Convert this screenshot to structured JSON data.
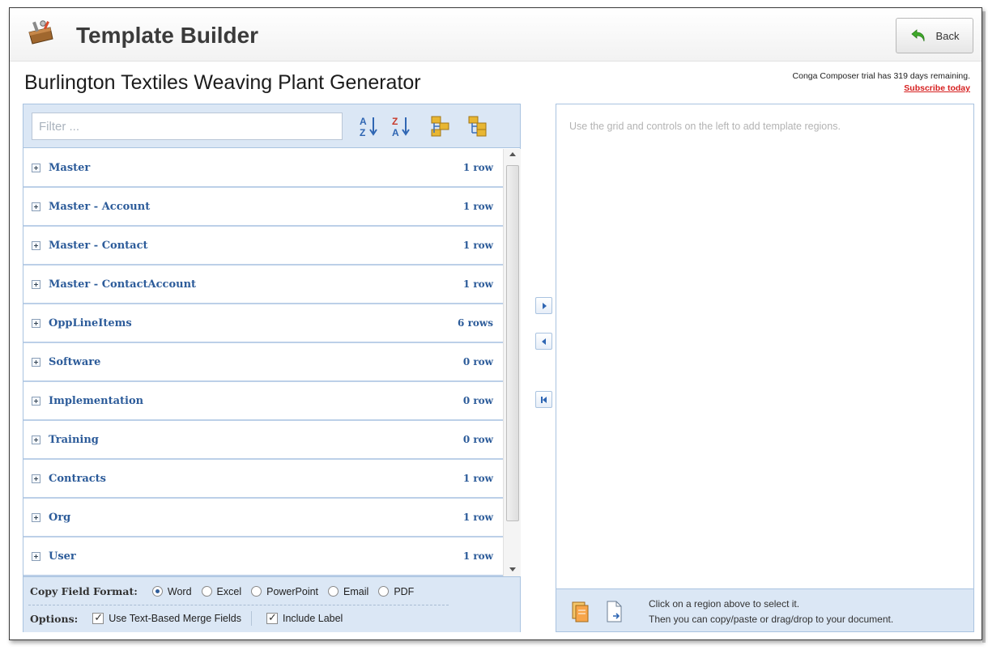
{
  "header": {
    "title": "Template Builder",
    "back_label": "Back"
  },
  "document": {
    "title": "Burlington Textiles Weaving Plant Generator"
  },
  "trial": {
    "message": "Conga Composer trial has 319 days remaining.",
    "subscribe": "Subscribe today"
  },
  "filter": {
    "placeholder": "Filter ..."
  },
  "toolbar_icons": [
    "sort-ascending-icon",
    "sort-descending-icon",
    "expand-all-icon",
    "collapse-all-icon"
  ],
  "regions": [
    {
      "name": "Master",
      "count": "1 row"
    },
    {
      "name": "Master - Account",
      "count": "1 row"
    },
    {
      "name": "Master - Contact",
      "count": "1 row"
    },
    {
      "name": "Master - ContactAccount",
      "count": "1 row"
    },
    {
      "name": "OppLineItems",
      "count": "6 rows"
    },
    {
      "name": "Software",
      "count": "0 row"
    },
    {
      "name": "Implementation",
      "count": "0 row"
    },
    {
      "name": "Training",
      "count": "0 row"
    },
    {
      "name": "Contracts",
      "count": "1 row"
    },
    {
      "name": "Org",
      "count": "1 row"
    },
    {
      "name": "User",
      "count": "1 row"
    }
  ],
  "copy_format": {
    "label": "Copy Field Format:",
    "options": [
      "Word",
      "Excel",
      "PowerPoint",
      "Email",
      "PDF"
    ],
    "selected": "Word"
  },
  "options": {
    "label": "Options:",
    "text_based": "Use Text-Based Merge Fields",
    "include_label": "Include Label"
  },
  "right": {
    "hint": "Use the grid and controls on the left to add template regions.",
    "footer_line1": "Click on a region above to select it.",
    "footer_line2": "Then you can copy/paste or drag/drop to your document."
  },
  "colors": {
    "link_blue": "#2d5c9a",
    "panel_bg": "#dbe7f5",
    "subscribe_red": "#d62020"
  }
}
